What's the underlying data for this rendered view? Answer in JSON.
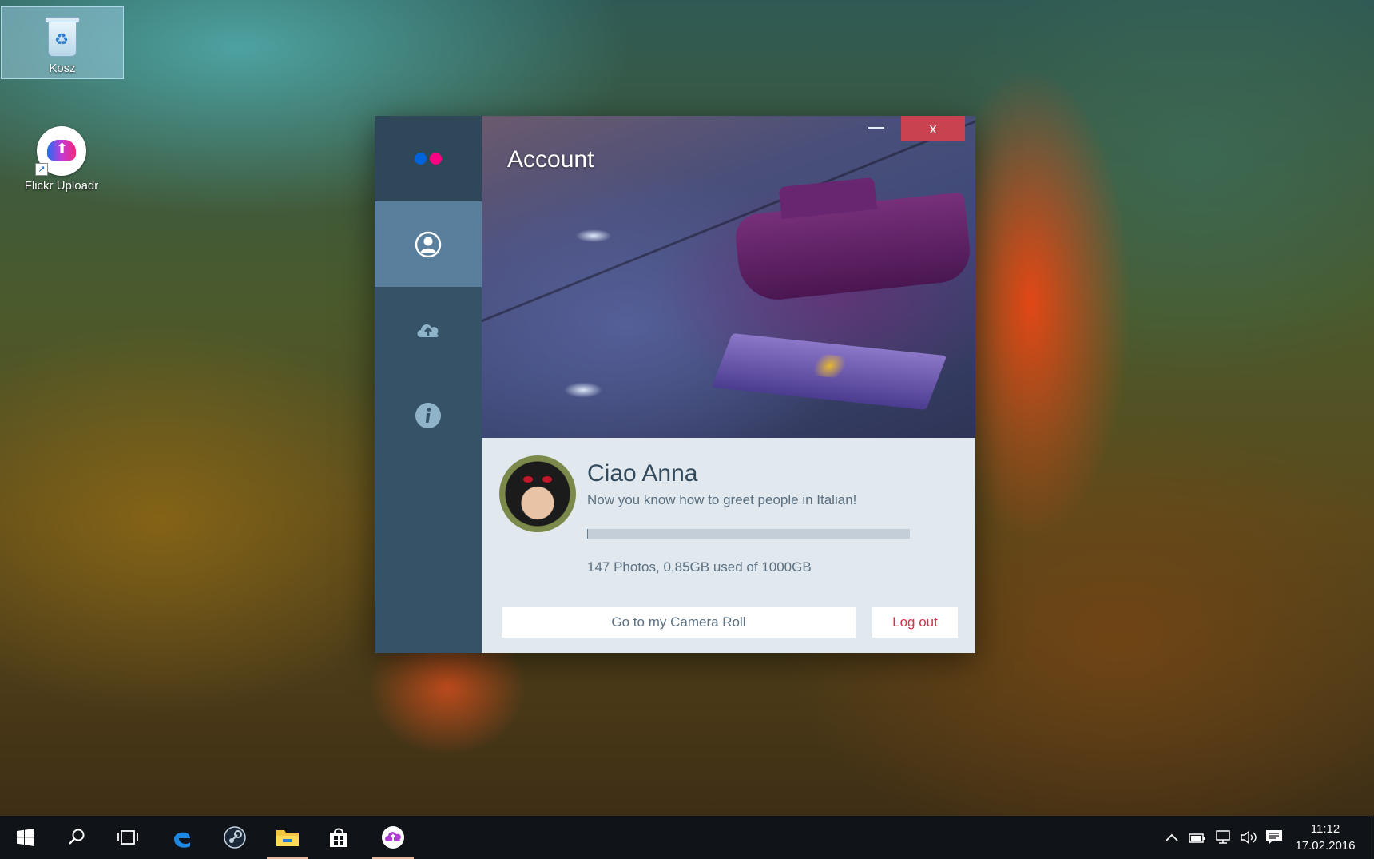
{
  "desktop": {
    "icons": [
      {
        "label": "Kosz",
        "icon": "recycle-bin-icon"
      },
      {
        "label": "Flickr Uploadr",
        "icon": "flickr-uploadr-icon"
      }
    ]
  },
  "app": {
    "page_title": "Account",
    "close_label": "x",
    "nav": [
      {
        "name": "account",
        "icon": "user-circle-icon",
        "active": true
      },
      {
        "name": "upload",
        "icon": "cloud-upload-icon",
        "active": false
      },
      {
        "name": "info",
        "icon": "info-icon",
        "active": false
      }
    ],
    "profile": {
      "greeting": "Ciao Anna",
      "subtitle": "Now you know how to greet people in Italian!",
      "storage_used_fraction": 0.00085,
      "stats": "147 Photos, 0,85GB used of 1000GB"
    },
    "buttons": {
      "camera_roll": "Go to my Camera Roll",
      "logout": "Log out"
    },
    "colors": {
      "sidebar": "#365266",
      "sidebar_active": "#5a7f9d",
      "close": "#c9424f",
      "logout_text": "#d6344a",
      "flickr_blue": "#0063dc",
      "flickr_pink": "#ff0084"
    }
  },
  "taskbar": {
    "items": [
      "start-icon",
      "search-icon",
      "task-view-icon",
      "edge-icon",
      "steam-icon",
      "file-explorer-icon",
      "store-icon",
      "flickr-uploadr-icon"
    ],
    "tray": [
      "chevron-up-icon",
      "battery-icon",
      "network-icon",
      "volume-icon",
      "action-center-icon"
    ],
    "time": "11:12",
    "date": "17.02.2016"
  }
}
